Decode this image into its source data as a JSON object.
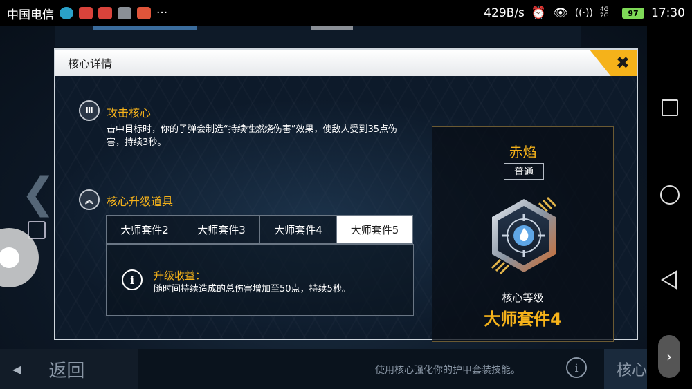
{
  "status_bar": {
    "carrier": "中国电信",
    "net_speed": "429B/s",
    "net_type": "4G 2G",
    "battery": "97",
    "time": "17:30",
    "overflow": "···"
  },
  "dialog": {
    "title": "核心详情",
    "close_label": "✖",
    "attack_section": {
      "title": "攻击核心",
      "icon": "bullets-icon",
      "description": "击中目标时，你的子弹会制造“持续性燃烧伤害”效果，使敌人受到35点伤害，持续3秒。"
    },
    "upgrade_section": {
      "title": "核心升级道具",
      "icon": "double-chevron-up-icon",
      "tabs": [
        {
          "label": "大师套件2",
          "active": false
        },
        {
          "label": "大师套件3",
          "active": false
        },
        {
          "label": "大师套件4",
          "active": false
        },
        {
          "label": "大师套件5",
          "active": true
        }
      ],
      "benefit_title": "升级收益：",
      "benefit_desc": "随时间持续造成的总伤害增加至50点，持续5秒。"
    },
    "core_card": {
      "name": "赤焰",
      "rarity": "普通",
      "level_label": "核心等级",
      "level": "大师套件4"
    }
  },
  "bottom_bar": {
    "back_label": "返回",
    "hint": "使用核心强化你的护甲套装技能。",
    "core_tab": "核心"
  },
  "colors": {
    "accent": "#f5b21a",
    "dialog_bg": "#0e1b2b"
  }
}
